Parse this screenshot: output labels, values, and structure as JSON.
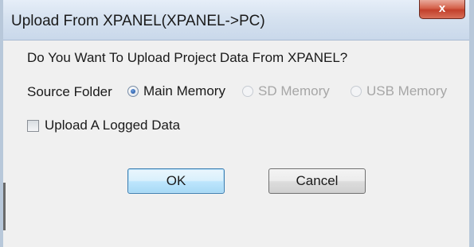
{
  "window": {
    "title": "Upload From XPANEL(XPANEL->PC)",
    "close_label": "x"
  },
  "dialog": {
    "question": "Do You Want To Upload Project Data From XPANEL?",
    "source_folder_label": "Source Folder",
    "source_options": [
      {
        "label": "Main Memory",
        "selected": true,
        "enabled": true
      },
      {
        "label": "SD Memory",
        "selected": false,
        "enabled": false
      },
      {
        "label": "USB Memory",
        "selected": false,
        "enabled": false
      }
    ],
    "logged_data_label": "Upload A Logged Data",
    "logged_data_checked": false
  },
  "buttons": {
    "ok_label": "OK",
    "cancel_label": "Cancel"
  },
  "colors": {
    "titlebar": "#d6e2f0",
    "close_button": "#c2402b",
    "dialog_background": "#f0f0f0",
    "disabled_text": "#a6a6a6"
  }
}
